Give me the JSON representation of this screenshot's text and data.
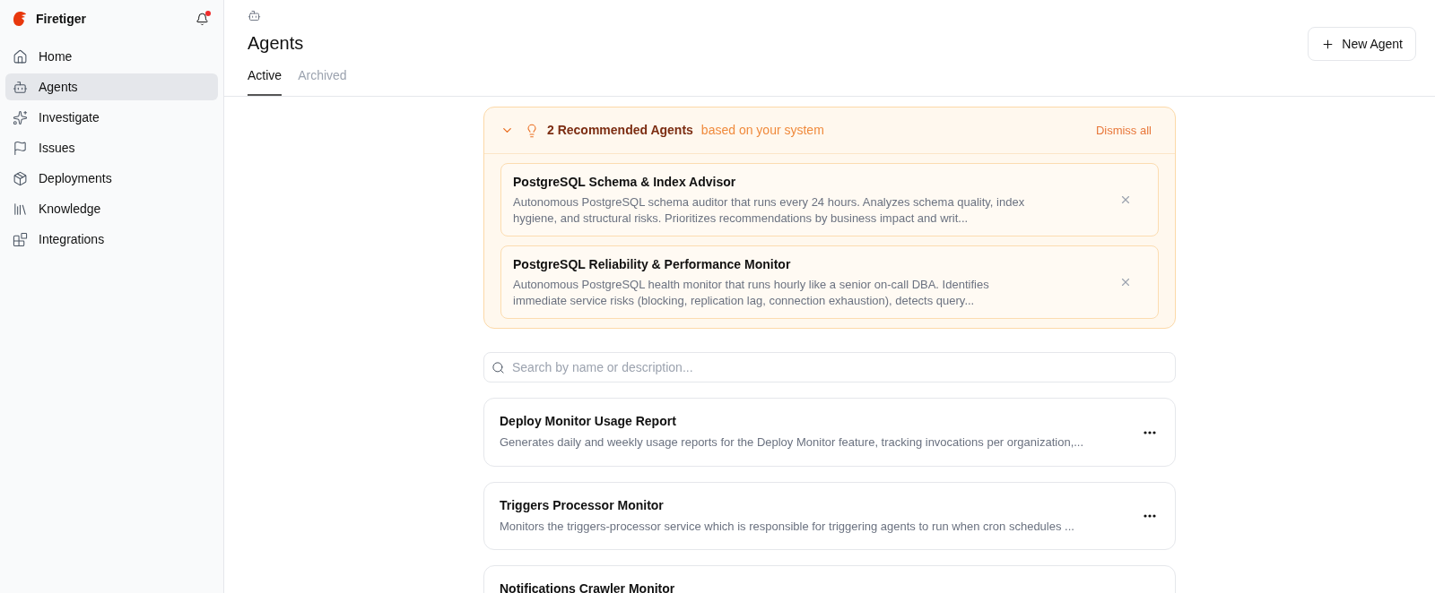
{
  "sidebar": {
    "brand": "Firetiger",
    "notifications": {
      "unread": true
    },
    "items": [
      {
        "label": "Home",
        "kind": "home",
        "selected": false
      },
      {
        "label": "Agents",
        "kind": "agents",
        "selected": true
      },
      {
        "label": "Investigate",
        "kind": "investigate",
        "selected": false
      },
      {
        "label": "Issues",
        "kind": "issues",
        "selected": false
      },
      {
        "label": "Deployments",
        "kind": "deployments",
        "selected": false
      },
      {
        "label": "Knowledge",
        "kind": "knowledge",
        "selected": false
      },
      {
        "label": "Integrations",
        "kind": "integrations",
        "selected": false
      }
    ]
  },
  "header": {
    "title": "Agents",
    "new_button": "New Agent",
    "tabs": [
      {
        "label": "Active",
        "selected": true
      },
      {
        "label": "Archived",
        "selected": false
      }
    ]
  },
  "recommendations": {
    "expanded": true,
    "title": "2 Recommended Agents",
    "subtitle": "based on your system",
    "dismiss_all": "Dismiss all",
    "items": [
      {
        "title": "PostgreSQL Schema & Index Advisor",
        "description": "Autonomous PostgreSQL schema auditor that runs every 24 hours. Analyzes schema quality, index hygiene, and structural risks. Prioritizes recommendations by business impact and writ..."
      },
      {
        "title": "PostgreSQL Reliability & Performance Monitor",
        "description": "Autonomous PostgreSQL health monitor that runs hourly like a senior on-call DBA. Identifies immediate service risks (blocking, replication lag, connection exhaustion), detects query..."
      }
    ]
  },
  "search": {
    "placeholder": "Search by name or description..."
  },
  "agents": [
    {
      "title": "Deploy Monitor Usage Report",
      "description": "Generates daily and weekly usage reports for the Deploy Monitor feature, tracking invocations per organization,..."
    },
    {
      "title": "Triggers Processor Monitor",
      "description": "Monitors the triggers-processor service which is responsible for triggering agents to run when cron schedules ..."
    },
    {
      "title": "Notifications Crawler Monitor"
    }
  ]
}
